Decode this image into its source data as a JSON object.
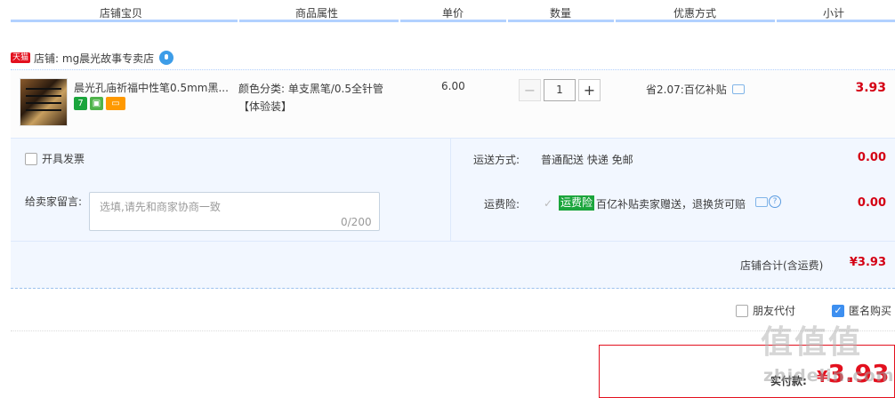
{
  "header": {
    "columns": [
      "店铺宝贝",
      "商品属性",
      "单价",
      "数量",
      "优惠方式",
      "小计"
    ]
  },
  "shop": {
    "badge": "天猫",
    "label": "店铺: mg晨光故事专卖店"
  },
  "item": {
    "title": "晨光孔庙祈福中性笔0.5mm黑...",
    "attr_line1": "颜色分类: 单支黑笔/0.5全针管",
    "attr_line2": "【体验装】",
    "price": "6.00",
    "quantity": "1",
    "minus": "−",
    "plus": "+",
    "discount": "省2.07:百亿补贴",
    "subtotal": "3.93"
  },
  "options": {
    "invoice_label": "开具发票",
    "note_label": "给卖家留言:",
    "note_placeholder": "选填,请先和商家协商一致",
    "note_count": "0/200",
    "ship_label": "运送方式:",
    "ship_value": "普通配送 快递 免邮",
    "ship_amount": "0.00",
    "insurance_label": "运费险:",
    "insurance_tag": "运费险",
    "insurance_desc": "百亿补贴卖家赠送，退换货可赔",
    "insurance_amount": "0.00"
  },
  "store_total": {
    "label": "店铺合计(含运费)",
    "amount": "¥3.93"
  },
  "footer": {
    "friend_pay_label": "朋友代付",
    "anonymous_label": "匿名购买",
    "pay_label": "实付款:",
    "pay_currency": "¥",
    "pay_amount": "3.93",
    "watermark": "值值值",
    "watermark_url": "zhidelin.com"
  },
  "colors": {
    "price_red": "#d40014",
    "accent_blue": "#3d8ff0",
    "panel_bg": "#f2f7ff"
  }
}
